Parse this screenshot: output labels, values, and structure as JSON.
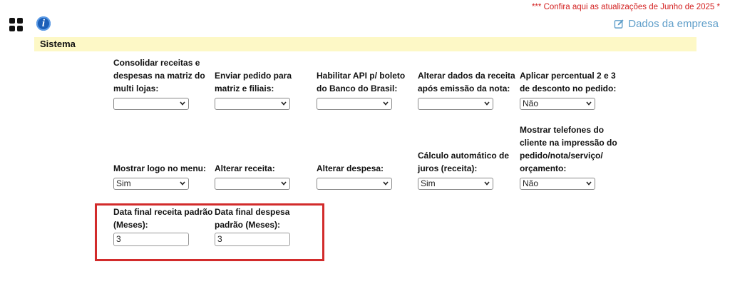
{
  "header": {
    "update_notice": "*** Confira aqui as atualizações de Junho de 2025 *",
    "company_link": "Dados da empresa",
    "info_glyph": "i"
  },
  "section": {
    "title": "Sistema"
  },
  "row1": [
    {
      "label": "Consolidar receitas e despesas na matriz do multi lojas:",
      "value": ""
    },
    {
      "label": "Enviar pedido para matriz e filiais:",
      "value": ""
    },
    {
      "label": "Habilitar API p/ boleto do Banco do Brasil:",
      "value": ""
    },
    {
      "label": "Alterar dados da receita após emissão da nota:",
      "value": ""
    },
    {
      "label": "Aplicar percentual 2 e 3 de desconto no pedido:",
      "value": "Não"
    }
  ],
  "row2": [
    {
      "label": "Mostrar logo no menu:",
      "value": "Sim"
    },
    {
      "label": "Alterar receita:",
      "value": ""
    },
    {
      "label": "Alterar despesa:",
      "value": ""
    },
    {
      "label": "Cálculo automático de juros (receita):",
      "value": "Sim"
    },
    {
      "label": "Mostrar telefones do cliente na impressão do pedido/nota/serviço/ orçamento:",
      "value": "Não"
    }
  ],
  "row3": [
    {
      "label": "Data final receita padrão (Meses):",
      "value": "3"
    },
    {
      "label": "Data final despesa padrão (Meses):",
      "value": "3"
    }
  ],
  "icons": [
    "apps-grid-icon",
    "info-icon",
    "edit-icon",
    "chevron-down-icon"
  ],
  "colors": {
    "notice": "#d32020",
    "link": "#5f9ec9",
    "section_bg": "#fdf8c6",
    "highlight": "#d22b2b"
  }
}
